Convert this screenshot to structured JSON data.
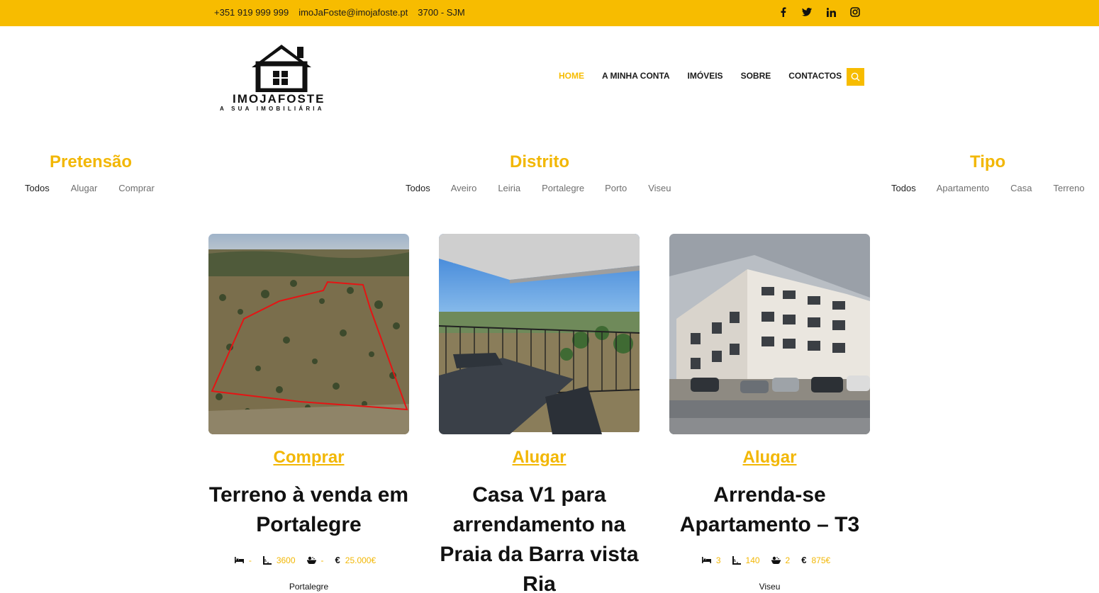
{
  "topbar": {
    "phone": "+351 919 999 999",
    "email": "imoJaFoste@imojafoste.pt",
    "location": "3700 - SJM",
    "social": [
      "facebook-icon",
      "twitter-icon",
      "linkedin-icon",
      "instagram-icon"
    ]
  },
  "logo": {
    "name": "IMOJAFOSTE",
    "tagline": "A SUA IMOBILIÁRIA"
  },
  "nav": {
    "home": "HOME",
    "account": "A MINHA CONTA",
    "properties": "IMÓVEIS",
    "about": "SOBRE",
    "contacts": "CONTACTOS"
  },
  "filters": {
    "pretensao": {
      "title": "Pretensão",
      "options": [
        "Todos",
        "Alugar",
        "Comprar"
      ]
    },
    "distrito": {
      "title": "Distrito",
      "options": [
        "Todos",
        "Aveiro",
        "Leiria",
        "Portalegre",
        "Porto",
        "Viseu"
      ]
    },
    "tipo": {
      "title": "Tipo",
      "options": [
        "Todos",
        "Apartamento",
        "Casa",
        "Terreno"
      ]
    }
  },
  "cards": [
    {
      "category": "Comprar",
      "title": "Terreno à venda em Portalegre",
      "rooms": "-",
      "area": "3600",
      "baths": "-",
      "price": "25.000€",
      "location": "Portalegre"
    },
    {
      "category": "Alugar",
      "title": "Casa V1 para arrendamento na Praia da Barra vista Ria",
      "rooms": "",
      "area": "",
      "baths": "",
      "price": "",
      "location": ""
    },
    {
      "category": "Alugar",
      "title": "Arrenda-se Apartamento – T3",
      "rooms": "3",
      "area": "140",
      "baths": "2",
      "price": "875€",
      "location": "Viseu"
    }
  ],
  "colors": {
    "accent": "#f7bc00",
    "accent_text": "#f2b705"
  }
}
